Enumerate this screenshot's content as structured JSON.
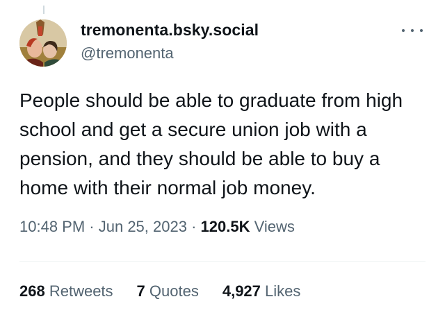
{
  "author": {
    "display_name": "tremonenta.bsky.social",
    "handle": "@tremonenta",
    "avatar": "medieval-painting-avatar"
  },
  "tweet": {
    "lines": [
      "People should be able to graduate from high",
      "school and get a secure union job with a",
      "pension, and they should be able to buy a",
      "home with their normal job money."
    ]
  },
  "meta": {
    "time": "10:48 PM",
    "separator": " · ",
    "date": "Jun 25, 2023",
    "views_count": "120.5K",
    "views_label": " Views"
  },
  "stats": {
    "retweets_count": "268",
    "retweets_label": " Retweets",
    "quotes_count": "7",
    "quotes_label": " Quotes",
    "likes_count": "4,927",
    "likes_label": " Likes"
  },
  "icons": {
    "more": "more-options-icon"
  },
  "colors": {
    "text_primary": "#0f1419",
    "text_secondary": "#536471",
    "divider": "#eff3f4"
  }
}
